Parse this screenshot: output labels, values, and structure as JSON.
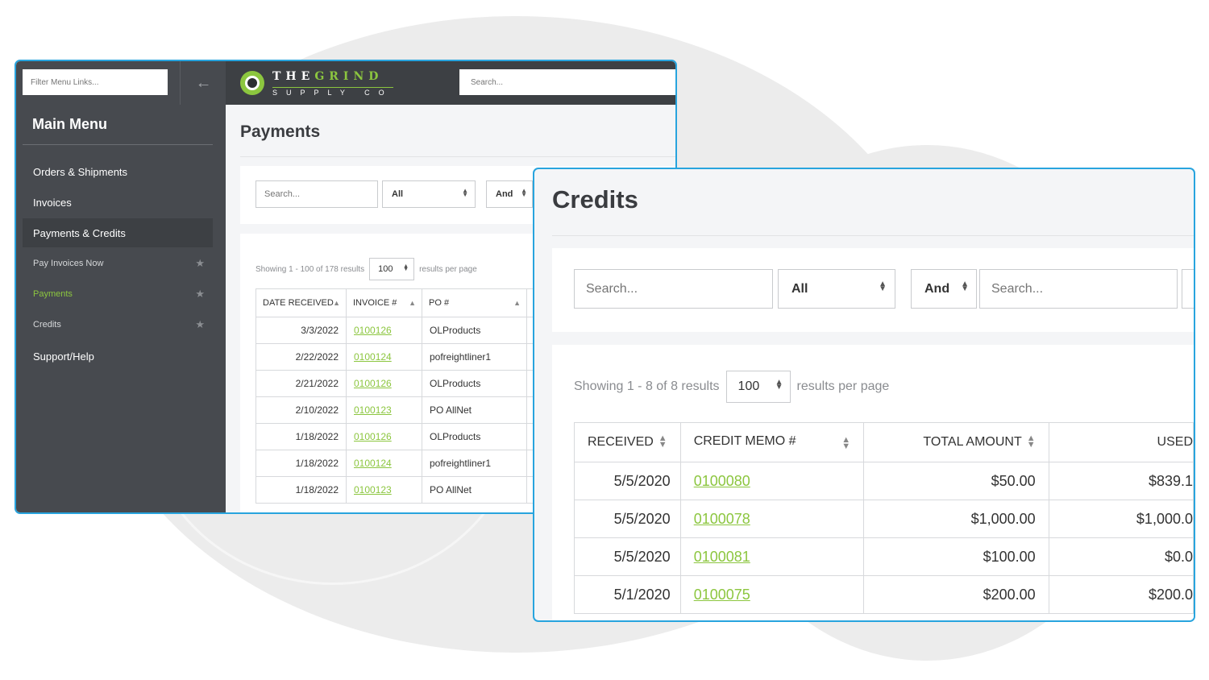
{
  "payments_window": {
    "sidebar": {
      "filter_placeholder": "Filter Menu Links...",
      "back_icon": "arrow-left-icon",
      "title": "Main Menu",
      "items": [
        {
          "label": "Orders & Shipments"
        },
        {
          "label": "Invoices"
        },
        {
          "label": "Payments & Credits"
        },
        {
          "label": "Pay Invoices Now"
        },
        {
          "label": "Payments"
        },
        {
          "label": "Credits"
        },
        {
          "label": "Support/Help"
        }
      ]
    },
    "header": {
      "logo_top": [
        "THE",
        "GRIND"
      ],
      "logo_bottom": "SUPPLY CO",
      "search_placeholder": "Search..."
    },
    "page_title": "Payments",
    "filters": {
      "search_placeholder": "Search...",
      "field_select": "All",
      "logic_select": "And"
    },
    "pagination": {
      "showing": "Showing 1 - 100 of 178 results",
      "per_page": "100",
      "suffix": "results per page"
    },
    "table": {
      "headers": [
        "DATE RECEIVED",
        "INVOICE #",
        "PO #"
      ],
      "rows": [
        {
          "date": "3/3/2022",
          "invoice": "0100126",
          "po": "OLProducts"
        },
        {
          "date": "2/22/2022",
          "invoice": "0100124",
          "po": "pofreightliner1"
        },
        {
          "date": "2/21/2022",
          "invoice": "0100126",
          "po": "OLProducts"
        },
        {
          "date": "2/10/2022",
          "invoice": "0100123",
          "po": "PO AllNet"
        },
        {
          "date": "1/18/2022",
          "invoice": "0100126",
          "po": "OLProducts"
        },
        {
          "date": "1/18/2022",
          "invoice": "0100124",
          "po": "pofreightliner1"
        },
        {
          "date": "1/18/2022",
          "invoice": "0100123",
          "po": "PO AllNet"
        }
      ]
    }
  },
  "credits_window": {
    "page_title": "Credits",
    "filters": {
      "search_placeholder": "Search...",
      "field_select": "All",
      "logic_select": "And",
      "search2_placeholder": "Search..."
    },
    "pagination": {
      "showing": "Showing 1 - 8 of 8 results",
      "per_page": "100",
      "suffix": "results per page"
    },
    "table": {
      "headers": [
        "RECEIVED",
        "CREDIT MEMO #",
        "TOTAL AMOUNT",
        "USED"
      ],
      "rows": [
        {
          "received": "5/5/2020",
          "memo": "0100080",
          "total": "$50.00",
          "used": "$839.1"
        },
        {
          "received": "5/5/2020",
          "memo": "0100078",
          "total": "$1,000.00",
          "used": "$1,000.0"
        },
        {
          "received": "5/5/2020",
          "memo": "0100081",
          "total": "$100.00",
          "used": "$0.0"
        },
        {
          "received": "5/1/2020",
          "memo": "0100075",
          "total": "$200.00",
          "used": "$200.0"
        }
      ]
    }
  },
  "colors": {
    "accent_green": "#8cc63f",
    "window_border": "#28a4de",
    "sidebar_bg": "#474a4f"
  }
}
